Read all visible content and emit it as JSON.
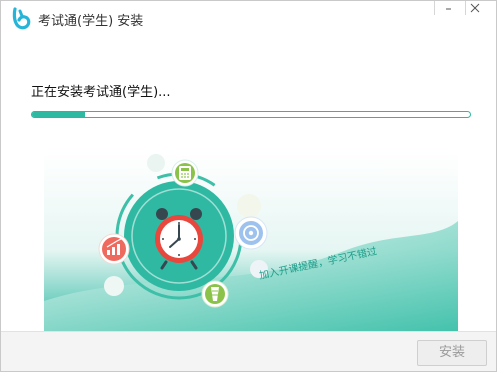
{
  "window": {
    "title": "考试通(学生) 安装"
  },
  "install": {
    "status": "正在安装考试通(学生)...",
    "progress": 0.12
  },
  "illustration": {
    "slogan": "加入开课提醒，学习不错过",
    "icons": [
      "calculator-icon",
      "chart-icon",
      "clock-icon",
      "compass-icon",
      "pen-icon"
    ]
  },
  "footer": {
    "install_label": "安装"
  },
  "colors": {
    "accent": "#2fb9a3",
    "accent_dark": "#1e9e8a",
    "clock_red": "#e8473e"
  }
}
